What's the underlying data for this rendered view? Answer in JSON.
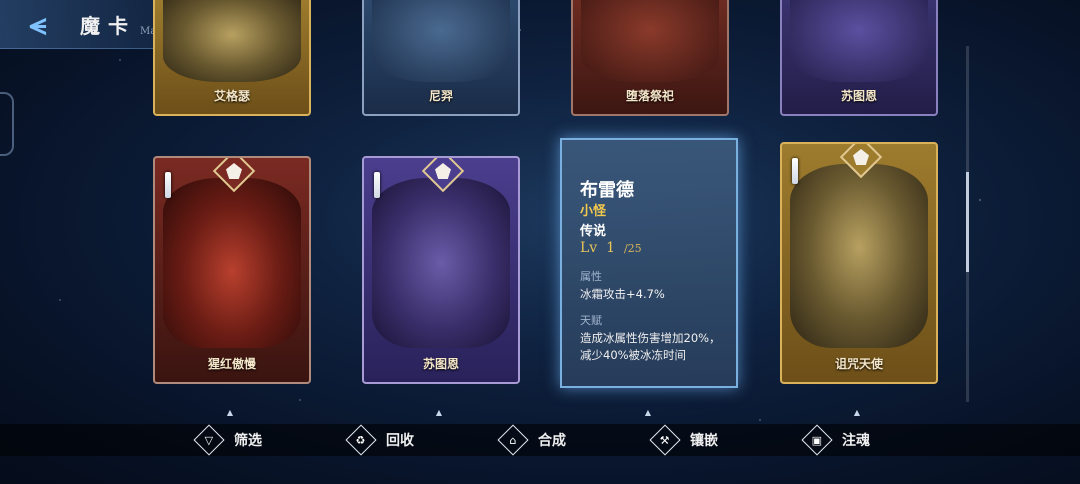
{
  "header": {
    "title": "魔卡",
    "subtitle": "MagicCard",
    "info_icon": "exclamation-icon",
    "back_icon": "back-arrow-icon"
  },
  "top_cards": [
    {
      "name": "艾格瑟",
      "frame": "gold"
    },
    {
      "name": "尼羿",
      "frame": "blue"
    },
    {
      "name": "堕落祭祀",
      "frame": "red"
    },
    {
      "name": "苏图恩",
      "frame": "purple"
    }
  ],
  "cards": [
    {
      "name": "猩红傲慢",
      "stars": 1,
      "frame": "crimson"
    },
    {
      "name": "苏图恩",
      "stars": 1,
      "frame": "violet"
    },
    {
      "name": "诅咒天使",
      "stars": 1,
      "frame": "gold"
    }
  ],
  "detail": {
    "name": "布雷德",
    "type": "小怪",
    "rarity": "传说",
    "level_prefix": "Lv",
    "level": "1",
    "level_max": "/25",
    "attribute_label": "属性",
    "attribute_value": "冰霜攻击+4.7%",
    "talent_label": "天赋",
    "talent_value": "造成冰属性伤害增加20%，减少40%被冰冻时间"
  },
  "actions": [
    {
      "label": "筛选",
      "icon": "filter-icon"
    },
    {
      "label": "回收",
      "icon": "recycle-icon"
    },
    {
      "label": "合成",
      "icon": "synthesize-icon"
    },
    {
      "label": "镶嵌",
      "icon": "inlay-icon"
    },
    {
      "label": "注魂",
      "icon": "soul-inject-icon"
    }
  ]
}
